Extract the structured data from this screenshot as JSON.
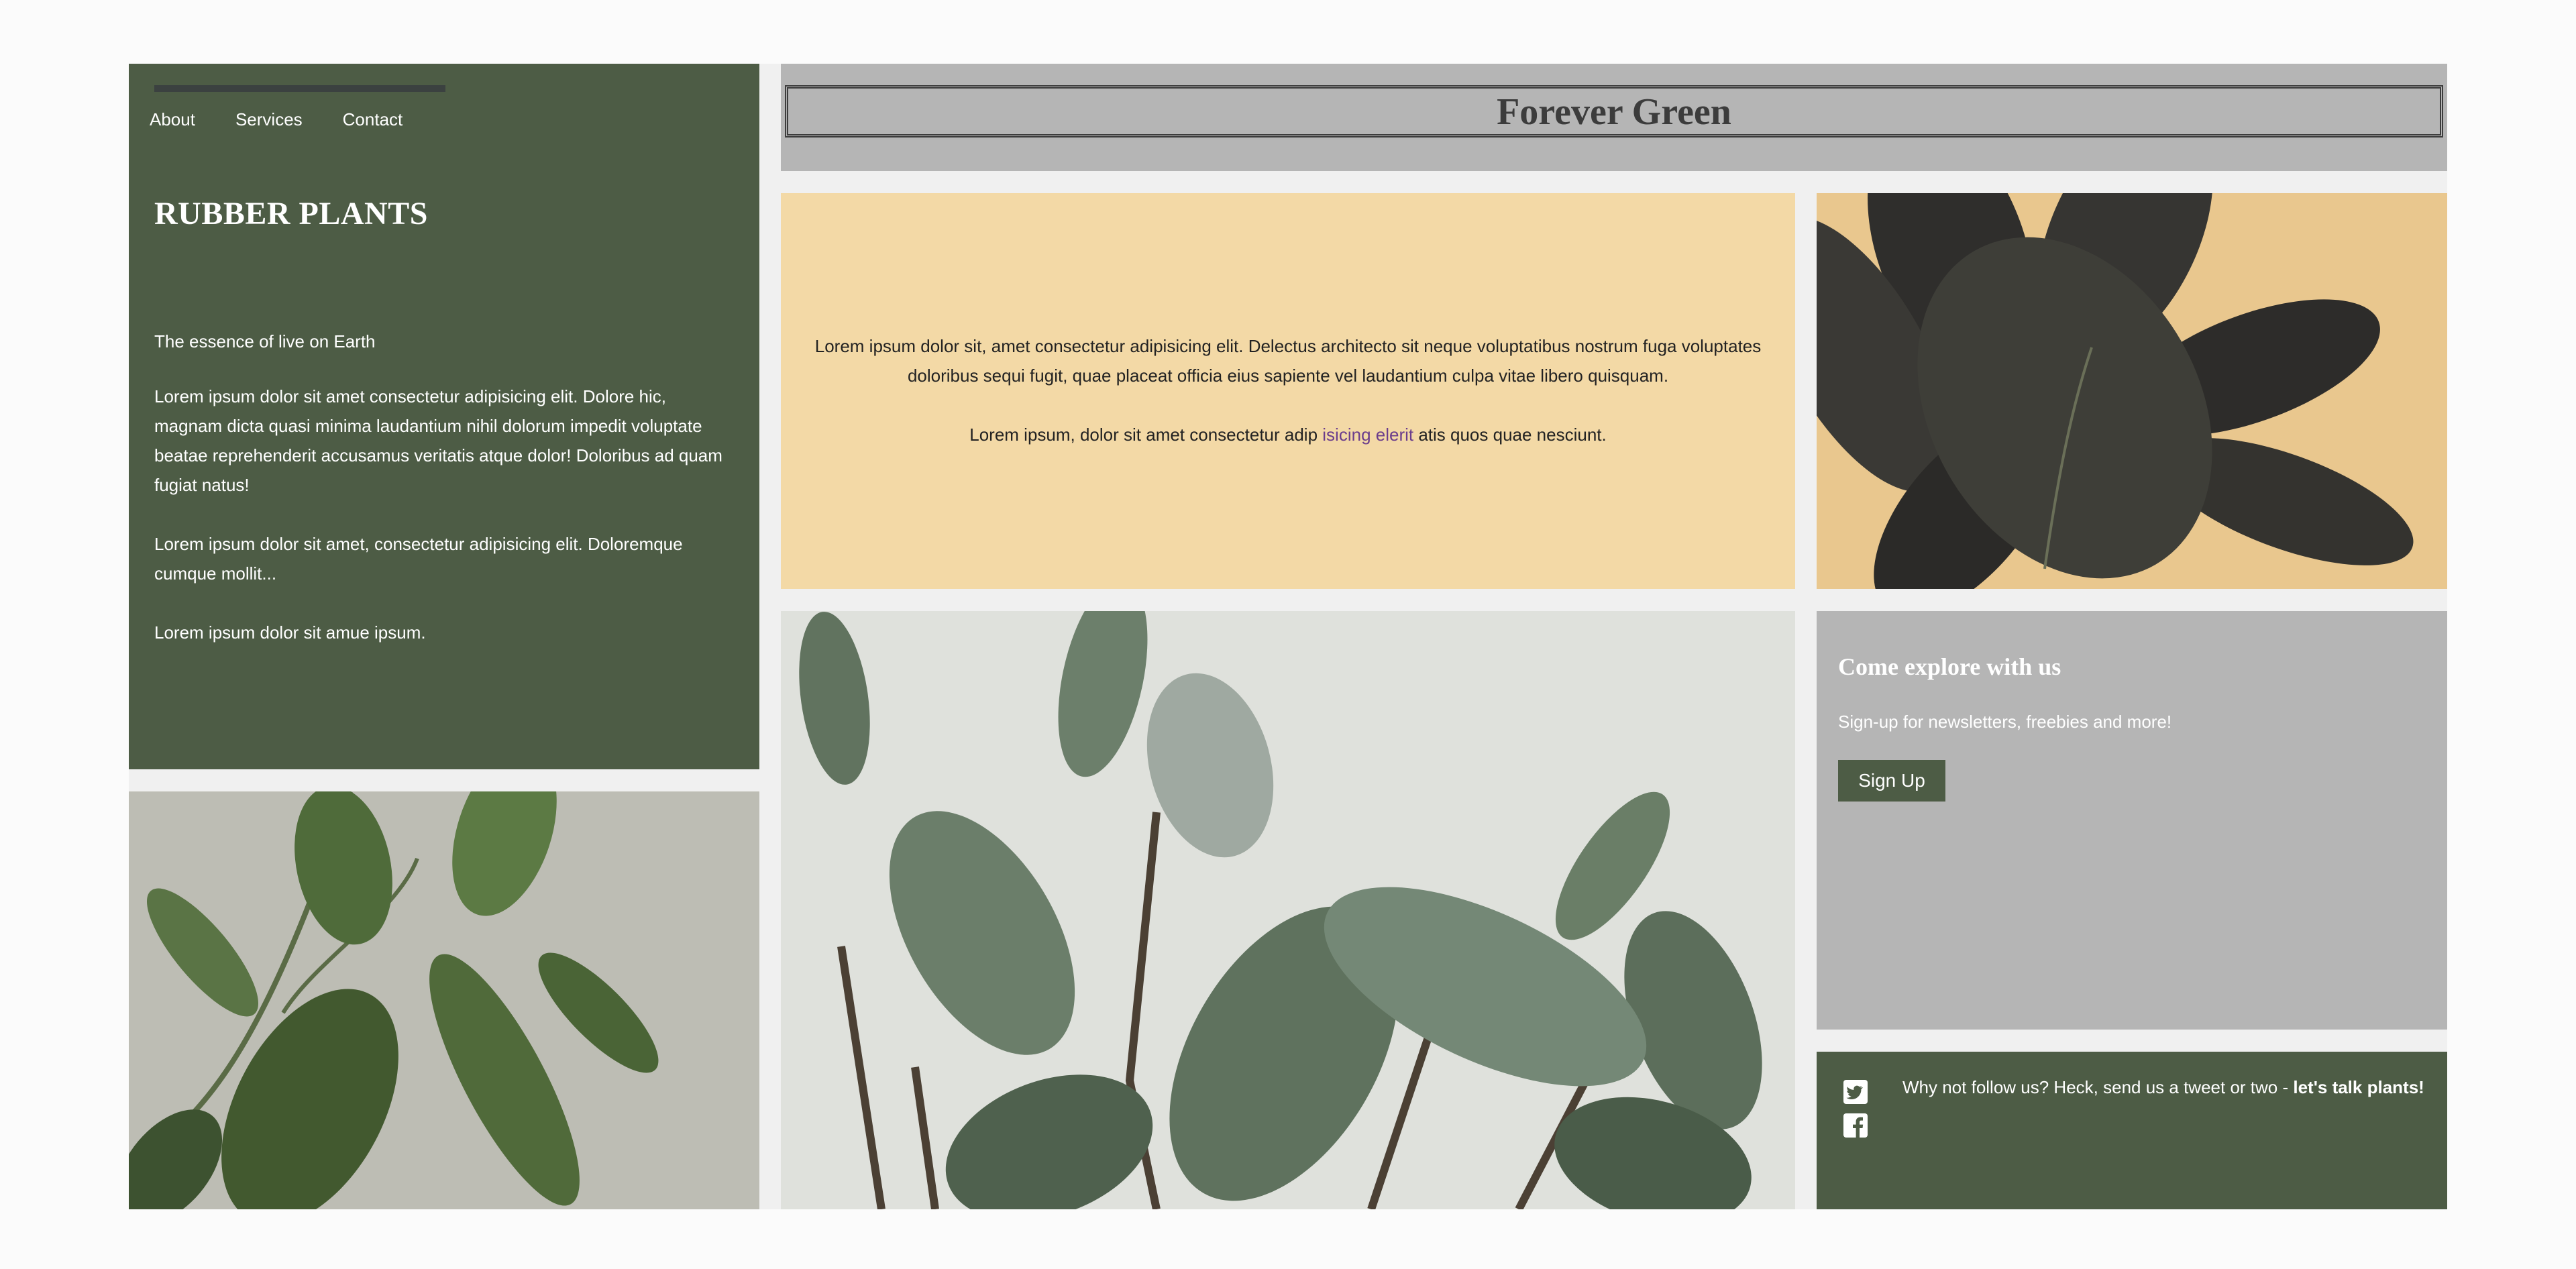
{
  "nav": {
    "items": [
      "About",
      "Services",
      "Contact"
    ]
  },
  "left_panel": {
    "title": "RUBBER PLANTS",
    "tagline": "The essence of live on Earth",
    "paragraph_1": "Lorem ipsum dolor sit amet consectetur adipisicing elit. Dolore hic, magnam dicta quasi minima laudantium nihil dolorum impedit voluptate beatae reprehenderit accusamus veritatis atque dolor! Doloribus ad quam fugiat natus!",
    "paragraph_2": "Lorem ipsum dolor sit amet, consectetur adipisicing elit. Doloremque cumque mollit...",
    "paragraph_3": "Lorem ipsum dolor sit amue ipsum."
  },
  "header": {
    "title": "Forever Green"
  },
  "intro": {
    "paragraph_1": "Lorem ipsum dolor sit, amet consectetur adipisicing elit. Delectus architecto sit neque voluptatibus nostrum fuga voluptates doloribus sequi fugit, quae placeat officia eius sapiente vel laudantium culpa vitae libero quisquam.",
    "paragraph_2_before": "Lorem ipsum, dolor sit amet consectetur adip ",
    "paragraph_2_link": "isicing elerit",
    "paragraph_2_after": " atis quos quae nesciunt."
  },
  "signup": {
    "title": "Come explore with us",
    "text": "Sign-up for newsletters, freebies and more!",
    "button_label": "Sign Up"
  },
  "social": {
    "text_prefix": "Why not follow us? Heck, send us a tweet or two - ",
    "text_bold": "let's talk plants!",
    "icons": [
      "twitter-icon",
      "facebook-icon"
    ]
  },
  "colors": {
    "green": "#4d5c45",
    "grey": "#b5b5b5",
    "sand": "#f3d9a6",
    "link": "#6b3d8c"
  }
}
